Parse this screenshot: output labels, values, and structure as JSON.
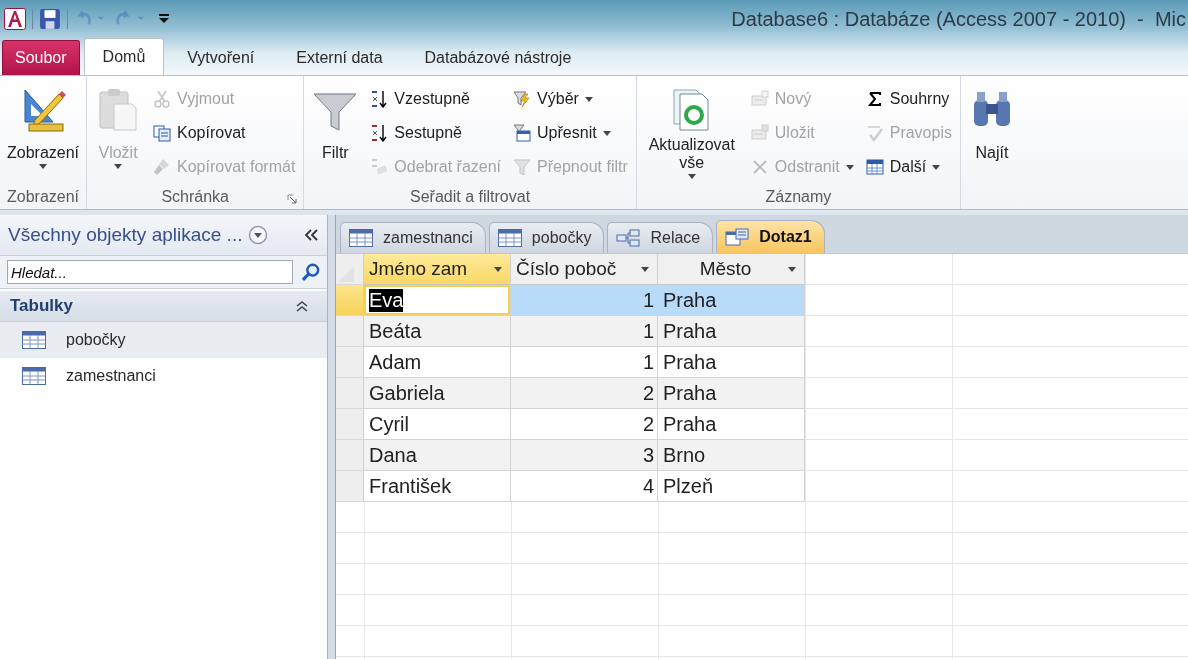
{
  "window": {
    "title": "Database6 : Databáze (Access 2007 - 2010)  -  Mic"
  },
  "quick_access": [
    {
      "kind": "save",
      "disabled": false
    },
    {
      "kind": "undo",
      "disabled": true
    },
    {
      "kind": "redo",
      "disabled": true
    },
    {
      "kind": "customize",
      "disabled": false
    }
  ],
  "ribbon_tabs": [
    {
      "label": "Soubor",
      "kind": "file",
      "selected": false
    },
    {
      "label": "Domů",
      "kind": "tab",
      "selected": true
    },
    {
      "label": "Vytvoření",
      "kind": "tab",
      "selected": false
    },
    {
      "label": "Externí data",
      "kind": "tab",
      "selected": false
    },
    {
      "label": "Databázové nástroje",
      "kind": "tab",
      "selected": false
    }
  ],
  "ribbon_groups": [
    {
      "label": "Zobrazení",
      "launcher": false,
      "items": [
        {
          "kind": "large",
          "label": "Zobrazení",
          "disabled": false,
          "dropdown": true
        }
      ]
    },
    {
      "label": "Schránka",
      "launcher": true,
      "items": [
        {
          "kind": "large",
          "label": "Vložit",
          "disabled": true,
          "dropdown": true
        },
        {
          "kind": "small",
          "label": "Vyjmout",
          "disabled": true,
          "dropdown": false
        },
        {
          "kind": "small",
          "label": "Kopírovat",
          "disabled": false,
          "dropdown": false
        },
        {
          "kind": "small",
          "label": "Kopírovat formát",
          "disabled": true,
          "dropdown": false
        }
      ]
    },
    {
      "label": "Seřadit a filtrovat",
      "launcher": false,
      "items": [
        {
          "kind": "large",
          "label": "Filtr",
          "disabled": false,
          "dropdown": false
        },
        {
          "kind": "small",
          "label": "Vzestupně",
          "disabled": false,
          "dropdown": false
        },
        {
          "kind": "small",
          "label": "Sestupně",
          "disabled": false,
          "dropdown": false
        },
        {
          "kind": "small",
          "label": "Odebrat řazení",
          "disabled": true,
          "dropdown": false
        },
        {
          "kind": "small",
          "label": "Výběr",
          "disabled": false,
          "dropdown": true
        },
        {
          "kind": "small",
          "label": "Upřesnit",
          "disabled": false,
          "dropdown": true
        },
        {
          "kind": "small",
          "label": "Přepnout filtr",
          "disabled": true,
          "dropdown": false
        }
      ]
    },
    {
      "label": "Záznamy",
      "launcher": false,
      "items": [
        {
          "kind": "large",
          "label": "Aktualizovat vše",
          "disabled": false,
          "dropdown": true
        },
        {
          "kind": "small",
          "label": "Nový",
          "disabled": true,
          "dropdown": false
        },
        {
          "kind": "small",
          "label": "Uložit",
          "disabled": true,
          "dropdown": false
        },
        {
          "kind": "small",
          "label": "Odstranit",
          "disabled": true,
          "dropdown": true
        },
        {
          "kind": "small",
          "label": "Souhrny",
          "disabled": false,
          "dropdown": false
        },
        {
          "kind": "small",
          "label": "Pravopis",
          "disabled": true,
          "dropdown": false
        },
        {
          "kind": "small",
          "label": "Další",
          "disabled": false,
          "dropdown": true
        }
      ]
    },
    {
      "items": [
        {
          "kind": "large",
          "label": "Najít",
          "disabled": false,
          "dropdown": false
        }
      ]
    }
  ],
  "navigation_pane": {
    "title": "Všechny objekty aplikace ...",
    "search": {
      "placeholder": "Hledat..."
    },
    "groups": [
      {
        "label": "Tabulky",
        "expanded": true,
        "items": [
          {
            "label": "pobočky",
            "selected": true
          },
          {
            "label": "zamestnanci",
            "selected": false
          }
        ]
      }
    ]
  },
  "document_tabs": [
    {
      "label": "zamestnanci",
      "kind": "table",
      "selected": false
    },
    {
      "label": "pobočky",
      "kind": "table",
      "selected": false
    },
    {
      "label": "Relace",
      "kind": "relationships",
      "selected": false
    },
    {
      "label": "Dotaz1",
      "kind": "query",
      "selected": true
    }
  ],
  "datasheet": {
    "columns": [
      {
        "label": "Jméno zam",
        "kind": "text",
        "selected": true
      },
      {
        "label": "Číslo poboč",
        "kind": "number",
        "selected": false
      },
      {
        "label": "Město",
        "kind": "text",
        "selected": false
      }
    ],
    "rows": [
      {
        "cells": [
          "Eva",
          "1",
          "Praha"
        ],
        "selected": true
      },
      {
        "cells": [
          "Beáta",
          "1",
          "Praha"
        ],
        "selected": false
      },
      {
        "cells": [
          "Adam",
          "1",
          "Praha"
        ],
        "selected": false
      },
      {
        "cells": [
          "Gabriela",
          "2",
          "Praha"
        ],
        "selected": false
      },
      {
        "cells": [
          "Cyril",
          "2",
          "Praha"
        ],
        "selected": false
      },
      {
        "cells": [
          "Dana",
          "3",
          "Brno"
        ],
        "selected": false
      },
      {
        "cells": [
          "František",
          "4",
          "Plzeň"
        ],
        "selected": false
      }
    ]
  }
}
